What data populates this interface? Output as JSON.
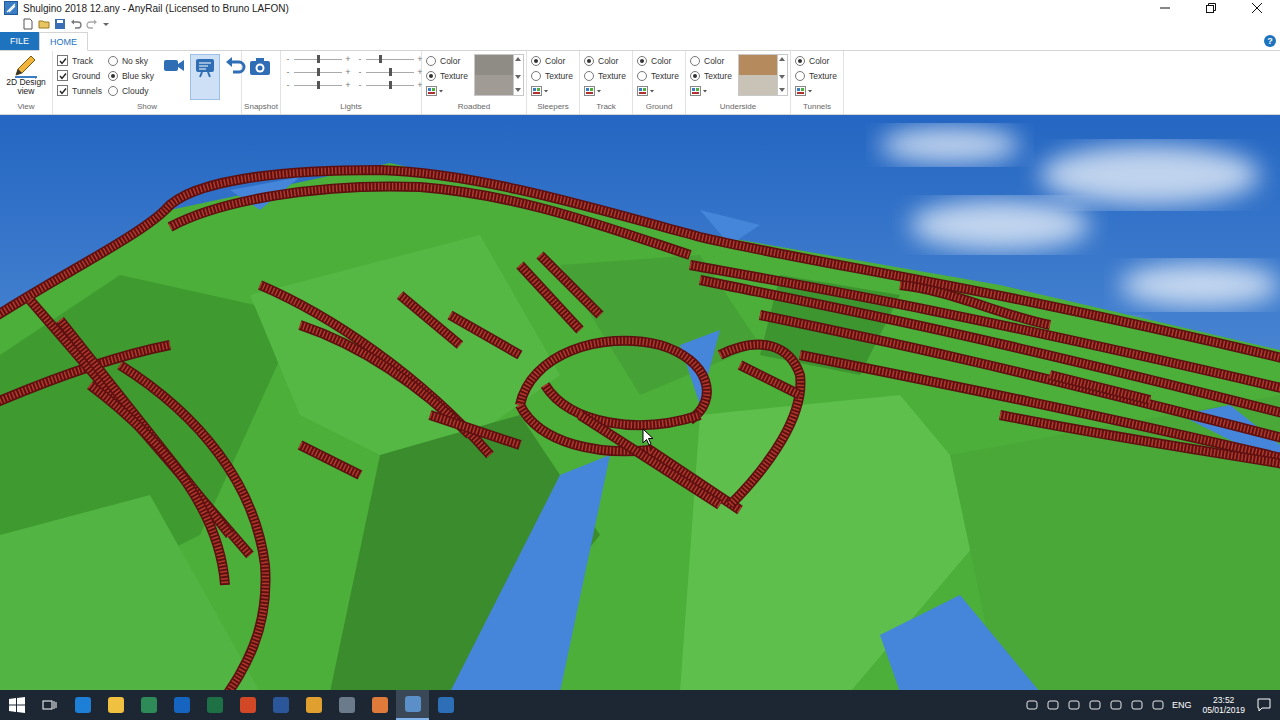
{
  "window": {
    "title": "Shulgino 2018 12.any - AnyRail (Licensed to Bruno LAFON)"
  },
  "ribbon": {
    "tabs": [
      {
        "label": "FILE",
        "selected": false
      },
      {
        "label": "HOME",
        "selected": true
      }
    ],
    "help": "?",
    "view": {
      "label": "View",
      "button": "2D Design view"
    },
    "show": {
      "label": "Show",
      "checks": [
        {
          "label": "Track",
          "checked": true
        },
        {
          "label": "Ground",
          "checked": true
        },
        {
          "label": "Tunnels",
          "checked": true
        }
      ],
      "sky": [
        {
          "label": "No sky",
          "selected": false
        },
        {
          "label": "Blue sky",
          "selected": true
        },
        {
          "label": "Cloudy",
          "selected": false
        }
      ],
      "camera_modes": [
        {
          "selected": false
        },
        {
          "selected": true
        }
      ]
    },
    "snapshot": {
      "label": "Snapshot"
    },
    "lights": {
      "label": "Lights",
      "minus": "-",
      "plus": "+",
      "sliders": [
        {
          "level": 0.5
        },
        {
          "level": 0.3
        },
        {
          "level": 0.5
        },
        {
          "level": 0.5
        },
        {
          "level": 0.5
        },
        {
          "level": 0.5
        }
      ]
    },
    "materials": [
      {
        "label": "Roadbed",
        "options": [
          {
            "label": "Color",
            "selected": false
          },
          {
            "label": "Texture",
            "selected": true
          }
        ],
        "swatch": [
          "#8f8c86",
          "#a09c95"
        ]
      },
      {
        "label": "Sleepers",
        "options": [
          {
            "label": "Color",
            "selected": true
          },
          {
            "label": "Texture",
            "selected": false
          }
        ],
        "swatch": []
      },
      {
        "label": "Track",
        "options": [
          {
            "label": "Color",
            "selected": true
          },
          {
            "label": "Texture",
            "selected": false
          }
        ],
        "swatch": []
      },
      {
        "label": "Ground",
        "options": [
          {
            "label": "Color",
            "selected": true
          },
          {
            "label": "Texture",
            "selected": false
          }
        ],
        "swatch": []
      },
      {
        "label": "Underside",
        "options": [
          {
            "label": "Color",
            "selected": false
          },
          {
            "label": "Texture",
            "selected": true
          }
        ],
        "swatch": [
          "#b58a5c",
          "#c9c2b6"
        ]
      },
      {
        "label": "Tunnels",
        "options": [
          {
            "label": "Color",
            "selected": true
          },
          {
            "label": "Texture",
            "selected": false
          }
        ],
        "swatch": []
      }
    ]
  },
  "taskbar": {
    "apps": [
      {
        "color": "#1e7fd6",
        "active": false
      },
      {
        "color": "#f0c040",
        "active": false
      },
      {
        "color": "#2e8b57",
        "active": false
      },
      {
        "color": "#1565c0",
        "active": false
      },
      {
        "color": "#1e7145",
        "active": false
      },
      {
        "color": "#d24726",
        "active": false
      },
      {
        "color": "#2b579a",
        "active": false
      },
      {
        "color": "#e0a030",
        "active": false
      },
      {
        "color": "#6b7b8b",
        "active": false
      },
      {
        "color": "#e07a3a",
        "active": false
      },
      {
        "color": "#5b8fc7",
        "active": true
      },
      {
        "color": "#2c6fb7",
        "active": false
      }
    ],
    "language": "ENG",
    "time": "23:52",
    "date": "05/01/2019"
  }
}
